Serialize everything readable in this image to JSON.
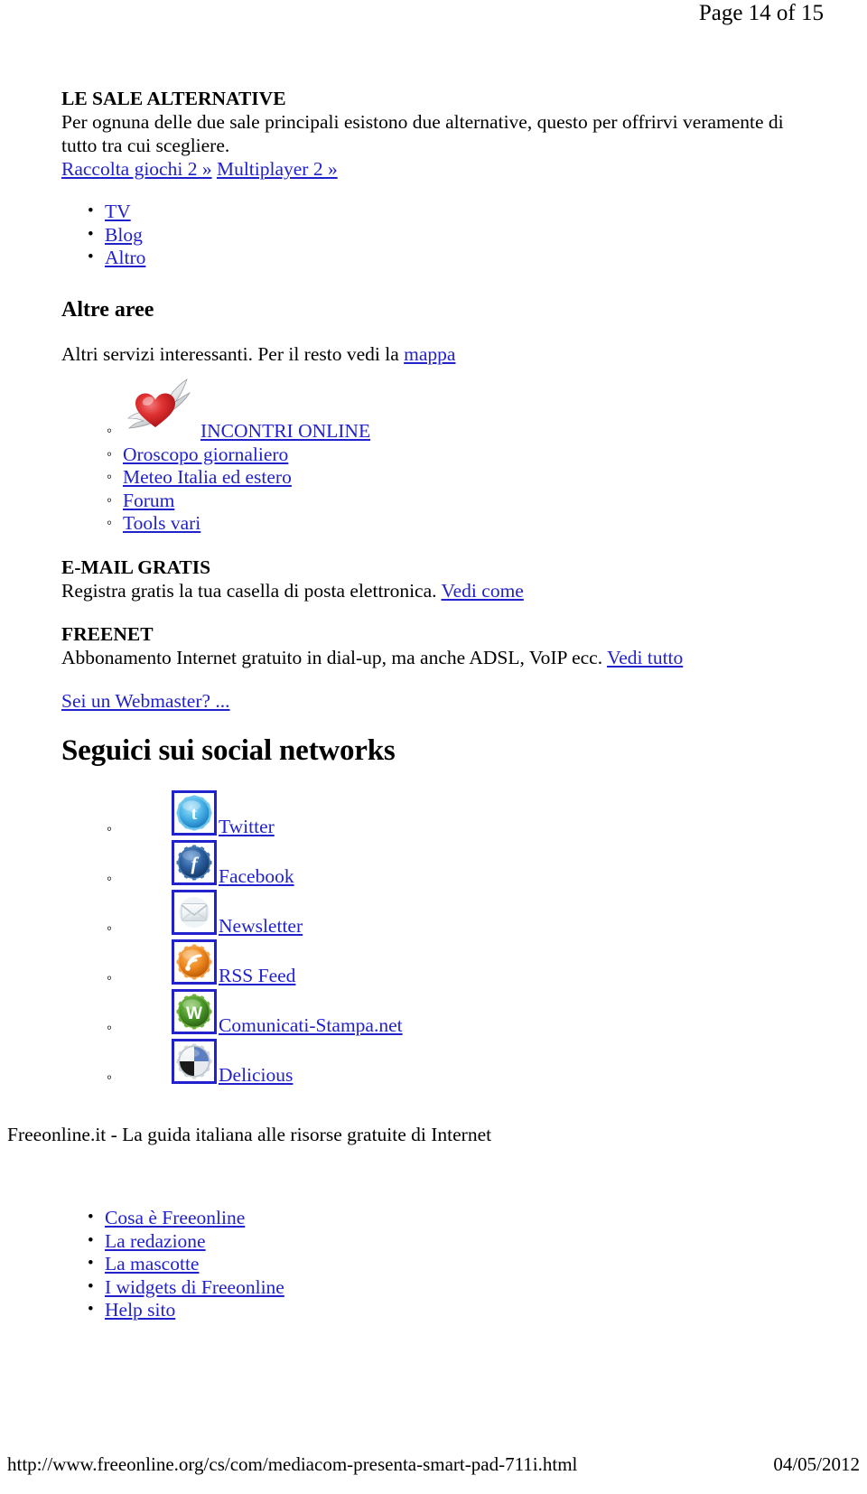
{
  "header": {
    "page_indicator": "Page 14 of 15"
  },
  "main": {
    "section_alternative": {
      "title": "LE SALE ALTERNATIVE",
      "body": "Per ognuna delle due sale principali esistono due alternative, questo per offrirvi veramente di tutto tra cui scegliere.",
      "links": [
        {
          "label": "Raccolta giochi 2 »"
        },
        {
          "label": "Multiplayer 2 »"
        }
      ],
      "list": [
        {
          "label": "TV"
        },
        {
          "label": "Blog"
        },
        {
          "label": "Altro"
        }
      ]
    },
    "section_altre_aree": {
      "heading": "Altre aree",
      "intro_prefix": "Altri servizi interessanti. Per il resto vedi la ",
      "intro_link": "mappa",
      "services": [
        {
          "label": "INCONTRI ONLINE",
          "icon": "winged-heart-icon"
        },
        {
          "label": "Oroscopo giornaliero"
        },
        {
          "label": "Meteo Italia ed estero"
        },
        {
          "label": "Forum"
        },
        {
          "label": "Tools vari"
        }
      ]
    },
    "section_email": {
      "heading": "E-MAIL GRATIS",
      "body": "Registra gratis la tua casella di posta elettronica. ",
      "link": "Vedi come"
    },
    "section_freenet": {
      "heading": "FREENET",
      "body": "Abbonamento Internet gratuito in dial-up, ma anche ADSL, VoIP ecc. ",
      "link": "Vedi tutto"
    },
    "webmaster_link": "Sei un Webmaster? ...",
    "section_social": {
      "heading": "Seguici sui social networks",
      "items": [
        {
          "label": "Twitter",
          "icon": "twitter-icon",
          "color": "#4ab3e8"
        },
        {
          "label": "Facebook",
          "icon": "facebook-icon",
          "color": "#2c5f9e"
        },
        {
          "label": "Newsletter",
          "icon": "envelope-icon",
          "color": "#e3e9ec"
        },
        {
          "label": "RSS Feed",
          "icon": "rss-icon",
          "color": "#ef8a20"
        },
        {
          "label": "Comunicati-Stampa.net",
          "icon": "comunicati-stampa-icon",
          "color": "#4c9a2a"
        },
        {
          "label": "Delicious",
          "icon": "delicious-icon",
          "color": "#5b7fc0"
        }
      ]
    },
    "tagline": "Freeonline.it - La guida italiana alle risorse gratuite di Internet",
    "bottom_links": [
      {
        "label": "Cosa è Freeonline"
      },
      {
        "label": "La redazione"
      },
      {
        "label": "La mascotte"
      },
      {
        "label": "I widgets di Freeonline"
      },
      {
        "label": "Help sito"
      }
    ]
  },
  "footer": {
    "url": "http://www.freeonline.org/cs/com/mediacom-presenta-smart-pad-711i.html",
    "date": "04/05/2012"
  },
  "colors": {
    "link": "#2222cc",
    "text": "#000000",
    "background": "#ffffff"
  }
}
